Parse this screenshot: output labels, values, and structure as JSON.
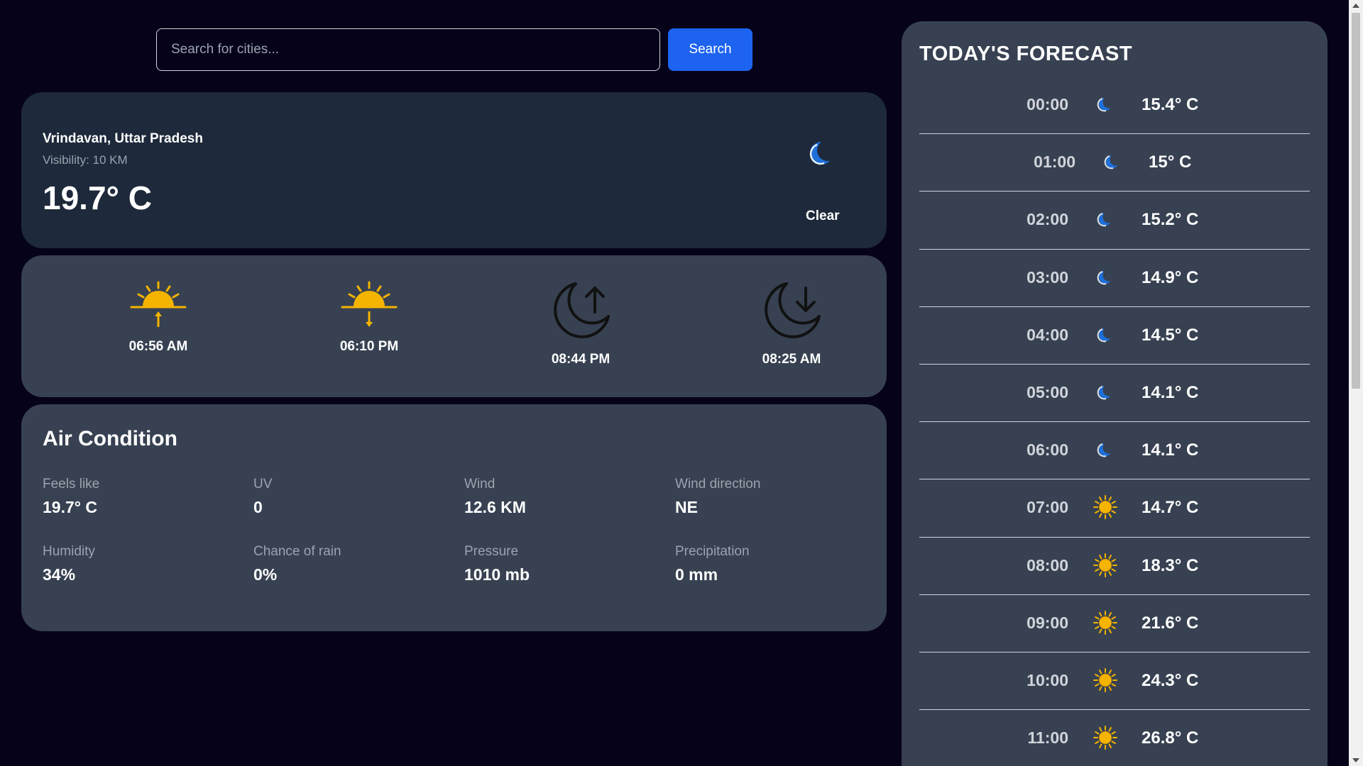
{
  "search": {
    "placeholder": "Search for cities...",
    "button_label": "Search"
  },
  "current": {
    "city": "Vrindavan, Uttar Pradesh",
    "visibility": "Visibility: 10 KM",
    "temperature": "19.7° C",
    "condition": "Clear",
    "condition_icon": "moon-icon"
  },
  "astro": [
    {
      "time": "06:56 AM",
      "icon": "sunrise-icon"
    },
    {
      "time": "06:10 PM",
      "icon": "sunset-icon"
    },
    {
      "time": "08:44 PM",
      "icon": "moonrise-icon"
    },
    {
      "time": "08:25 AM",
      "icon": "moonset-icon"
    }
  ],
  "air": {
    "title": "Air Condition",
    "metrics": [
      {
        "label": "Feels like",
        "value": "19.7° C"
      },
      {
        "label": "UV",
        "value": "0"
      },
      {
        "label": "Wind",
        "value": "12.6 KM"
      },
      {
        "label": "Wind direction",
        "value": "NE"
      },
      {
        "label": "Humidity",
        "value": "34%"
      },
      {
        "label": "Chance of rain",
        "value": "0%"
      },
      {
        "label": "Pressure",
        "value": "1010 mb"
      },
      {
        "label": "Precipitation",
        "value": "0 mm"
      }
    ]
  },
  "forecast": {
    "title": "TODAY'S FORECAST",
    "hours": [
      {
        "time": "00:00",
        "temp": "15.4° C",
        "icon": "moon-icon"
      },
      {
        "time": "01:00",
        "temp": "15° C",
        "icon": "moon-icon"
      },
      {
        "time": "02:00",
        "temp": "15.2° C",
        "icon": "moon-icon"
      },
      {
        "time": "03:00",
        "temp": "14.9° C",
        "icon": "moon-icon"
      },
      {
        "time": "04:00",
        "temp": "14.5° C",
        "icon": "moon-icon"
      },
      {
        "time": "05:00",
        "temp": "14.1° C",
        "icon": "moon-icon"
      },
      {
        "time": "06:00",
        "temp": "14.1° C",
        "icon": "moon-icon"
      },
      {
        "time": "07:00",
        "temp": "14.7° C",
        "icon": "sun-icon"
      },
      {
        "time": "08:00",
        "temp": "18.3° C",
        "icon": "sun-icon"
      },
      {
        "time": "09:00",
        "temp": "21.6° C",
        "icon": "sun-icon"
      },
      {
        "time": "10:00",
        "temp": "24.3° C",
        "icon": "sun-icon"
      },
      {
        "time": "11:00",
        "temp": "26.8° C",
        "icon": "sun-icon"
      }
    ]
  },
  "colors": {
    "background": "#05021a",
    "card_dark": "#1e293b",
    "card": "#374151",
    "accent": "#1d63f0",
    "sun": "#f5b400",
    "moon": "#1e6fd9"
  }
}
